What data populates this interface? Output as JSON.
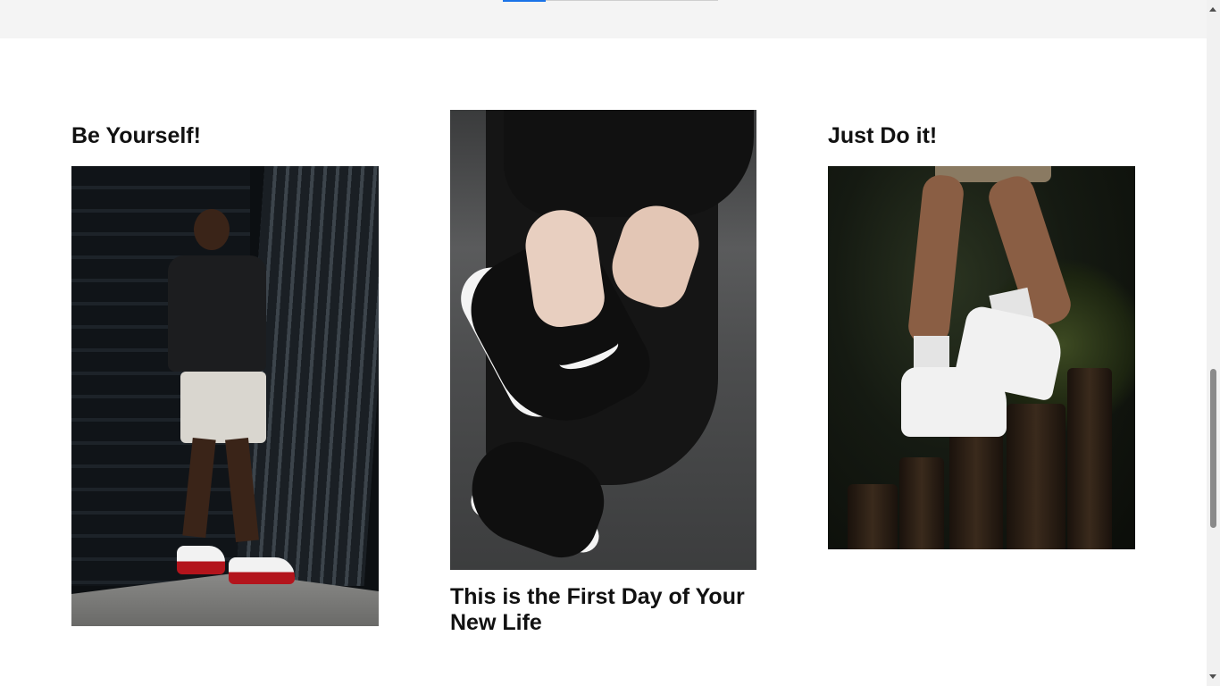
{
  "cards": [
    {
      "title": "Be Yourself!"
    },
    {
      "title": "This is the First Day of Your New Life"
    },
    {
      "title": "Just Do it!"
    }
  ]
}
